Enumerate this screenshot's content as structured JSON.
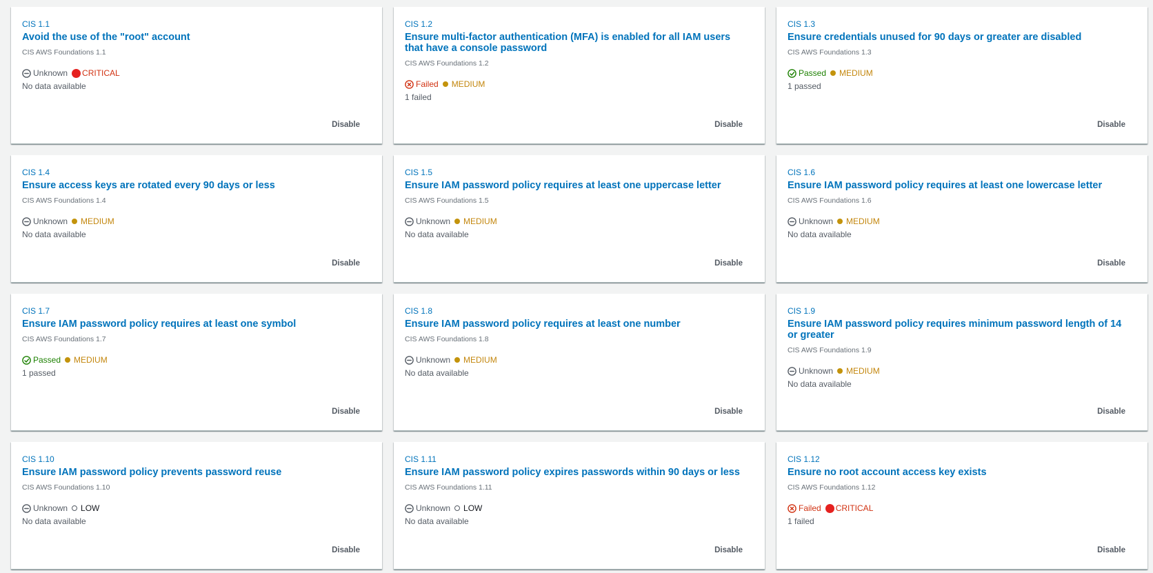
{
  "cards": [
    {
      "id": "CIS 1.1",
      "title": "Avoid the use of the \"root\" account",
      "subtitle": "CIS AWS Foundations 1.1",
      "status": "Unknown",
      "status_type": "unknown",
      "severity": "CRITICAL",
      "severity_type": "critical",
      "result": "No data available",
      "action": "Disable"
    },
    {
      "id": "CIS 1.2",
      "title": "Ensure multi-factor authentication (MFA) is enabled for all IAM users that have a console password",
      "subtitle": "CIS AWS Foundations 1.2",
      "status": "Failed",
      "status_type": "failed",
      "severity": "MEDIUM",
      "severity_type": "medium",
      "result": "1 failed",
      "action": "Disable"
    },
    {
      "id": "CIS 1.3",
      "title": "Ensure credentials unused for 90 days or greater are disabled",
      "subtitle": "CIS AWS Foundations 1.3",
      "status": "Passed",
      "status_type": "passed",
      "severity": "MEDIUM",
      "severity_type": "medium",
      "result": "1 passed",
      "action": "Disable"
    },
    {
      "id": "CIS 1.4",
      "title": "Ensure access keys are rotated every 90 days or less",
      "subtitle": "CIS AWS Foundations 1.4",
      "status": "Unknown",
      "status_type": "unknown",
      "severity": "MEDIUM",
      "severity_type": "medium",
      "result": "No data available",
      "action": "Disable"
    },
    {
      "id": "CIS 1.5",
      "title": "Ensure IAM password policy requires at least one uppercase letter",
      "subtitle": "CIS AWS Foundations 1.5",
      "status": "Unknown",
      "status_type": "unknown",
      "severity": "MEDIUM",
      "severity_type": "medium",
      "result": "No data available",
      "action": "Disable"
    },
    {
      "id": "CIS 1.6",
      "title": "Ensure IAM password policy requires at least one lowercase letter",
      "subtitle": "CIS AWS Foundations 1.6",
      "status": "Unknown",
      "status_type": "unknown",
      "severity": "MEDIUM",
      "severity_type": "medium",
      "result": "No data available",
      "action": "Disable"
    },
    {
      "id": "CIS 1.7",
      "title": "Ensure IAM password policy requires at least one symbol",
      "subtitle": "CIS AWS Foundations 1.7",
      "status": "Passed",
      "status_type": "passed",
      "severity": "MEDIUM",
      "severity_type": "medium",
      "result": "1 passed",
      "action": "Disable"
    },
    {
      "id": "CIS 1.8",
      "title": "Ensure IAM password policy requires at least one number",
      "subtitle": "CIS AWS Foundations 1.8",
      "status": "Unknown",
      "status_type": "unknown",
      "severity": "MEDIUM",
      "severity_type": "medium",
      "result": "No data available",
      "action": "Disable"
    },
    {
      "id": "CIS 1.9",
      "title": "Ensure IAM password policy requires minimum password length of 14 or greater",
      "subtitle": "CIS AWS Foundations 1.9",
      "status": "Unknown",
      "status_type": "unknown",
      "severity": "MEDIUM",
      "severity_type": "medium",
      "result": "No data available",
      "action": "Disable"
    },
    {
      "id": "CIS 1.10",
      "title": "Ensure IAM password policy prevents password reuse",
      "subtitle": "CIS AWS Foundations 1.10",
      "status": "Unknown",
      "status_type": "unknown",
      "severity": "LOW",
      "severity_type": "low",
      "result": "No data available",
      "action": "Disable"
    },
    {
      "id": "CIS 1.11",
      "title": "Ensure IAM password policy expires passwords within 90 days or less",
      "subtitle": "CIS AWS Foundations 1.11",
      "status": "Unknown",
      "status_type": "unknown",
      "severity": "LOW",
      "severity_type": "low",
      "result": "No data available",
      "action": "Disable"
    },
    {
      "id": "CIS 1.12",
      "title": "Ensure no root account access key exists",
      "subtitle": "CIS AWS Foundations 1.12",
      "status": "Failed",
      "status_type": "failed",
      "severity": "CRITICAL",
      "severity_type": "critical",
      "result": "1 failed",
      "action": "Disable"
    }
  ],
  "colors": {
    "link": "#0073bb",
    "passed": "#1d8102",
    "failed": "#d13212",
    "critical": "#e5211f",
    "medium": "#c3930c",
    "unknown": "#545b64"
  },
  "icons": {
    "unknown": "minus-circle-icon",
    "passed": "check-circle-icon",
    "failed": "x-circle-icon",
    "critical": "critical-dot-icon",
    "medium": "medium-dot-icon",
    "low": "low-dot-icon"
  }
}
